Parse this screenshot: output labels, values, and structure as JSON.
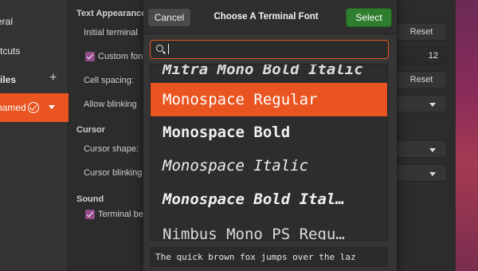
{
  "sidebar": {
    "items": [
      {
        "label": "eral"
      },
      {
        "label": "rtcuts"
      },
      {
        "label": "files"
      },
      {
        "label": "named"
      }
    ]
  },
  "settings": {
    "sections": {
      "text_appearance": "Text Appearance",
      "cursor": "Cursor",
      "sound": "Sound"
    },
    "initial_terminal_label": "Initial terminal",
    "custom_font_label": "Custom fon",
    "cell_spacing_label": "Cell spacing:",
    "allow_blinking_label": "Allow blinking",
    "cursor_shape_label": "Cursor shape:",
    "cursor_blinking_label": "Cursor blinking",
    "terminal_bell_label": "Terminal be",
    "reset_label": "Reset",
    "font_size_value": "12"
  },
  "dialog": {
    "title": "Choose A Terminal Font",
    "cancel_label": "Cancel",
    "select_label": "Select",
    "search": {
      "value": ""
    },
    "fonts": [
      {
        "label": "Mitra Mono Bold Italic"
      },
      {
        "label": "Monospace Regular",
        "selected": true
      },
      {
        "label": "Monospace Bold"
      },
      {
        "label": "Monospace Italic"
      },
      {
        "label": "Monospace Bold Ital…"
      },
      {
        "label": "Nimbus Mono PS Regu…"
      }
    ],
    "preview_text": "The quick brown fox jumps over the laz"
  },
  "colors": {
    "accent": "#e95420",
    "select_button": "#2f7d2f",
    "checkbox": "#924d8b"
  }
}
